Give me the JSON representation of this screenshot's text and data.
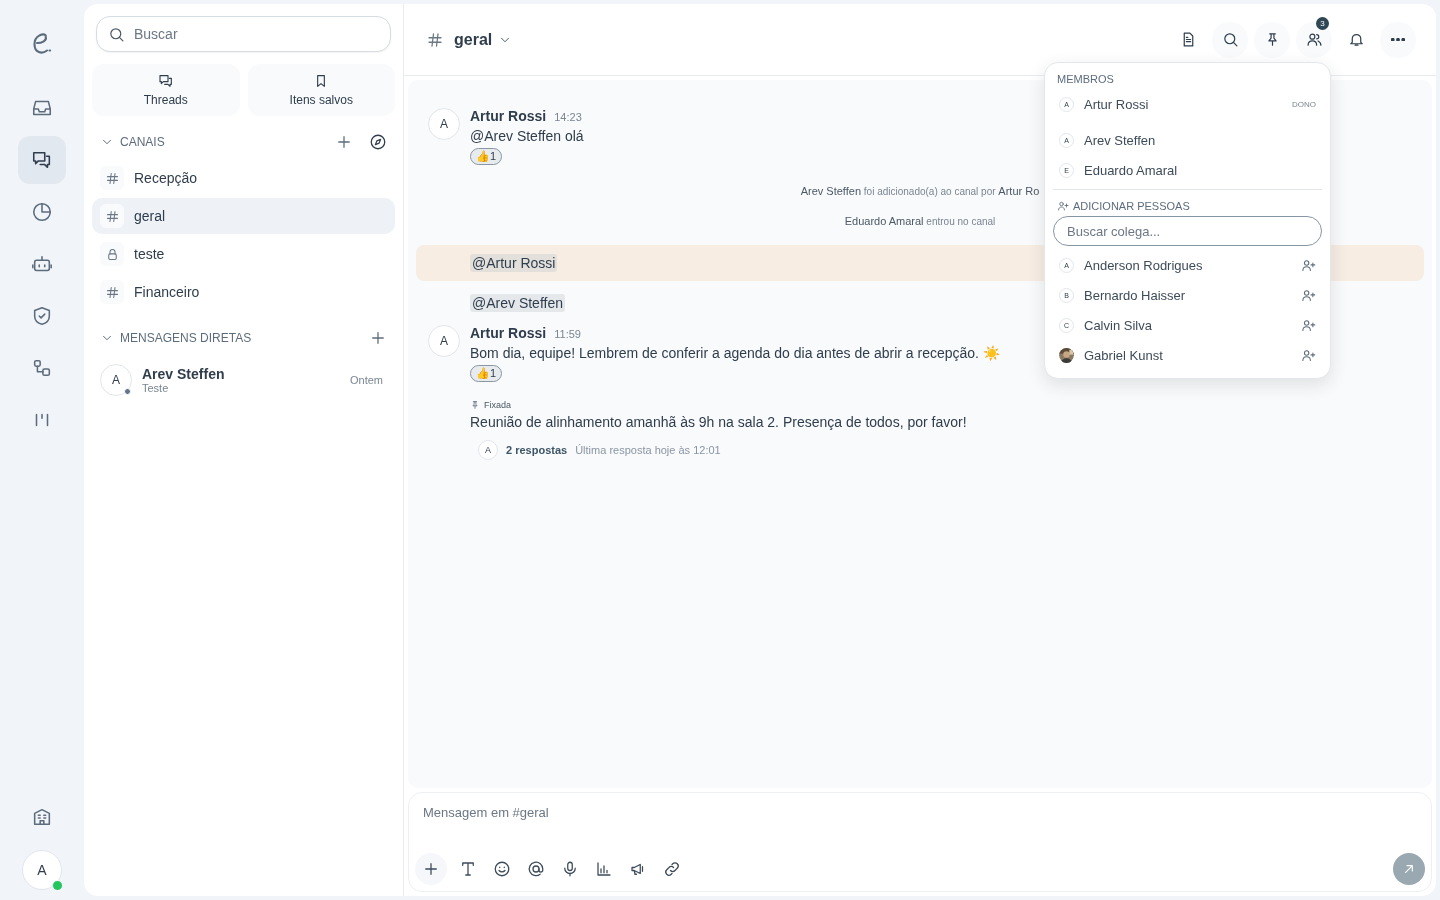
{
  "rail": {
    "items": [
      {
        "kind": "inbox",
        "selected": false
      },
      {
        "kind": "chat",
        "selected": true
      },
      {
        "kind": "pie",
        "selected": false
      },
      {
        "kind": "bot",
        "selected": false
      },
      {
        "kind": "shield",
        "selected": false
      },
      {
        "kind": "nodes",
        "selected": false
      },
      {
        "kind": "bars",
        "selected": false
      }
    ],
    "user": {
      "initial": "A",
      "online": true
    }
  },
  "sidebar": {
    "search": {
      "placeholder": "Buscar"
    },
    "shortcuts": [
      {
        "kind": "threads",
        "label": "Threads"
      },
      {
        "kind": "bookmark",
        "label": "Itens salvos"
      }
    ],
    "channels_heading": "CANAIS",
    "channels": [
      {
        "kind": "hash",
        "name": "Recepção",
        "selected": false
      },
      {
        "kind": "hash",
        "name": "geral",
        "selected": true
      },
      {
        "kind": "lock",
        "name": "teste",
        "selected": false
      },
      {
        "kind": "hash",
        "name": "Financeiro",
        "selected": false
      }
    ],
    "dm_heading": "MENSAGENS DIRETAS",
    "dms": [
      {
        "initial": "A",
        "name": "Arev Steffen",
        "preview": "Teste",
        "time": "Ontem",
        "online": false
      }
    ]
  },
  "header": {
    "channel": "geral",
    "members_badge": "3"
  },
  "messages": [
    {
      "kind": "message",
      "initial": "A",
      "author": "Artur Rossi",
      "time": "14:23",
      "text": "@Arev Steffen olá",
      "reaction": {
        "emoji": "👍",
        "count": "1"
      }
    },
    {
      "kind": "system",
      "text": "**Arev Steffen** foi adicionado(a) ao canal por **Artur Ro**"
    },
    {
      "kind": "system",
      "text": "**Eduardo Amaral** entrou no canal"
    },
    {
      "kind": "mention",
      "text": "@Artur Rossi",
      "highlighted": true
    },
    {
      "kind": "mention",
      "text": "@Arev Steffen",
      "highlighted": false
    },
    {
      "kind": "message",
      "initial": "A",
      "author": "Artur Rossi",
      "time": "11:59",
      "text": "Bom dia, equipe! Lembrem de conferir a agenda do dia antes de abrir a recepção. ☀️",
      "reaction": {
        "emoji": "👍",
        "count": "1"
      }
    },
    {
      "kind": "pinned",
      "label": "Fixada",
      "text": "Reunião de alinhamento amanhã às 9h na sala 2. Presença de todos, por favor!",
      "thread": {
        "initial": "A",
        "replies": "2 respostas",
        "last": "Última resposta hoje às 12:01"
      }
    }
  ],
  "members_popup": {
    "heading": "MEMBROS",
    "members": [
      {
        "kind": "letter",
        "initial": "A",
        "name": "Artur Rossi",
        "role": "DONO"
      },
      {
        "kind": "letter",
        "initial": "A",
        "name": "Arev Steffen"
      },
      {
        "kind": "letter",
        "initial": "E",
        "name": "Eduardo Amaral"
      }
    ],
    "add_heading": "ADICIONAR PESSOAS",
    "search": {
      "placeholder": "Buscar colega..."
    },
    "candidates": [
      {
        "kind": "letter",
        "initial": "A",
        "name": "Anderson Rodrigues"
      },
      {
        "kind": "letter",
        "initial": "B",
        "name": "Bernardo Haisser"
      },
      {
        "kind": "letter",
        "initial": "C",
        "name": "Calvin Silva"
      },
      {
        "name": "Gabriel Kunst"
      }
    ]
  },
  "composer": {
    "placeholder": "Mensagem em #geral"
  }
}
